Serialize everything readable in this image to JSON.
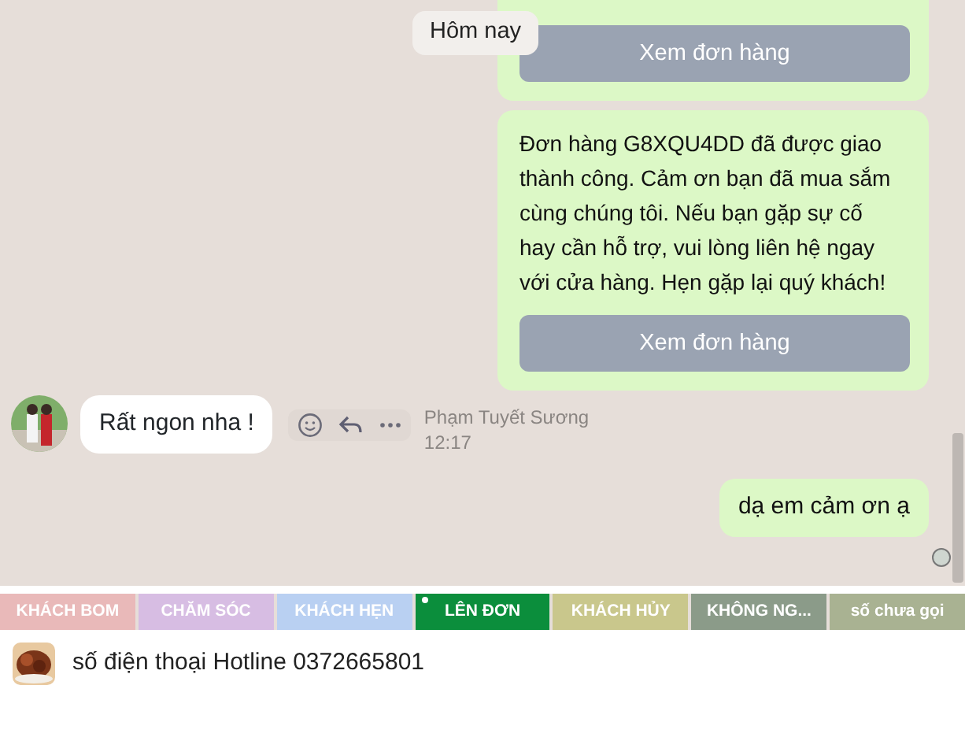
{
  "date_divider": "Hôm nay",
  "messages": [
    {
      "kind": "order",
      "button": "Xem đơn hàng"
    },
    {
      "kind": "order",
      "text": "Đơn hàng G8XQU4DD đã được giao thành công. Cảm ơn bạn đã mua sắm cùng chúng tôi. Nếu bạn gặp sự cố hay cần hỗ trợ, vui lòng liên hệ ngay với cửa hàng. Hẹn gặp lại quý khách!",
      "button": "Xem đơn hàng"
    },
    {
      "kind": "incoming",
      "text": "Rất ngon nha !",
      "sender": "Phạm Tuyết Sương",
      "time": "12:17"
    },
    {
      "kind": "outgoing",
      "text": "dạ em cảm ơn ạ"
    }
  ],
  "tags": [
    {
      "label": "KHÁCH BOM",
      "color": "#e9b9b9",
      "selected": false
    },
    {
      "label": "CHĂM SÓC",
      "color": "#d7bde3",
      "selected": false
    },
    {
      "label": "KHÁCH HẸN",
      "color": "#b9d0f2",
      "selected": false
    },
    {
      "label": "LÊN ĐƠN",
      "color": "#0b8e3c",
      "selected": true
    },
    {
      "label": "KHÁCH HỦY",
      "color": "#c9c78c",
      "selected": false
    },
    {
      "label": "KHÔNG NG...",
      "color": "#8b9b89",
      "selected": false
    },
    {
      "label": "số chưa gọi",
      "color": "#a9b292",
      "selected": false
    }
  ],
  "composer": {
    "value": "số điện thoại Hotline 0372665801"
  }
}
